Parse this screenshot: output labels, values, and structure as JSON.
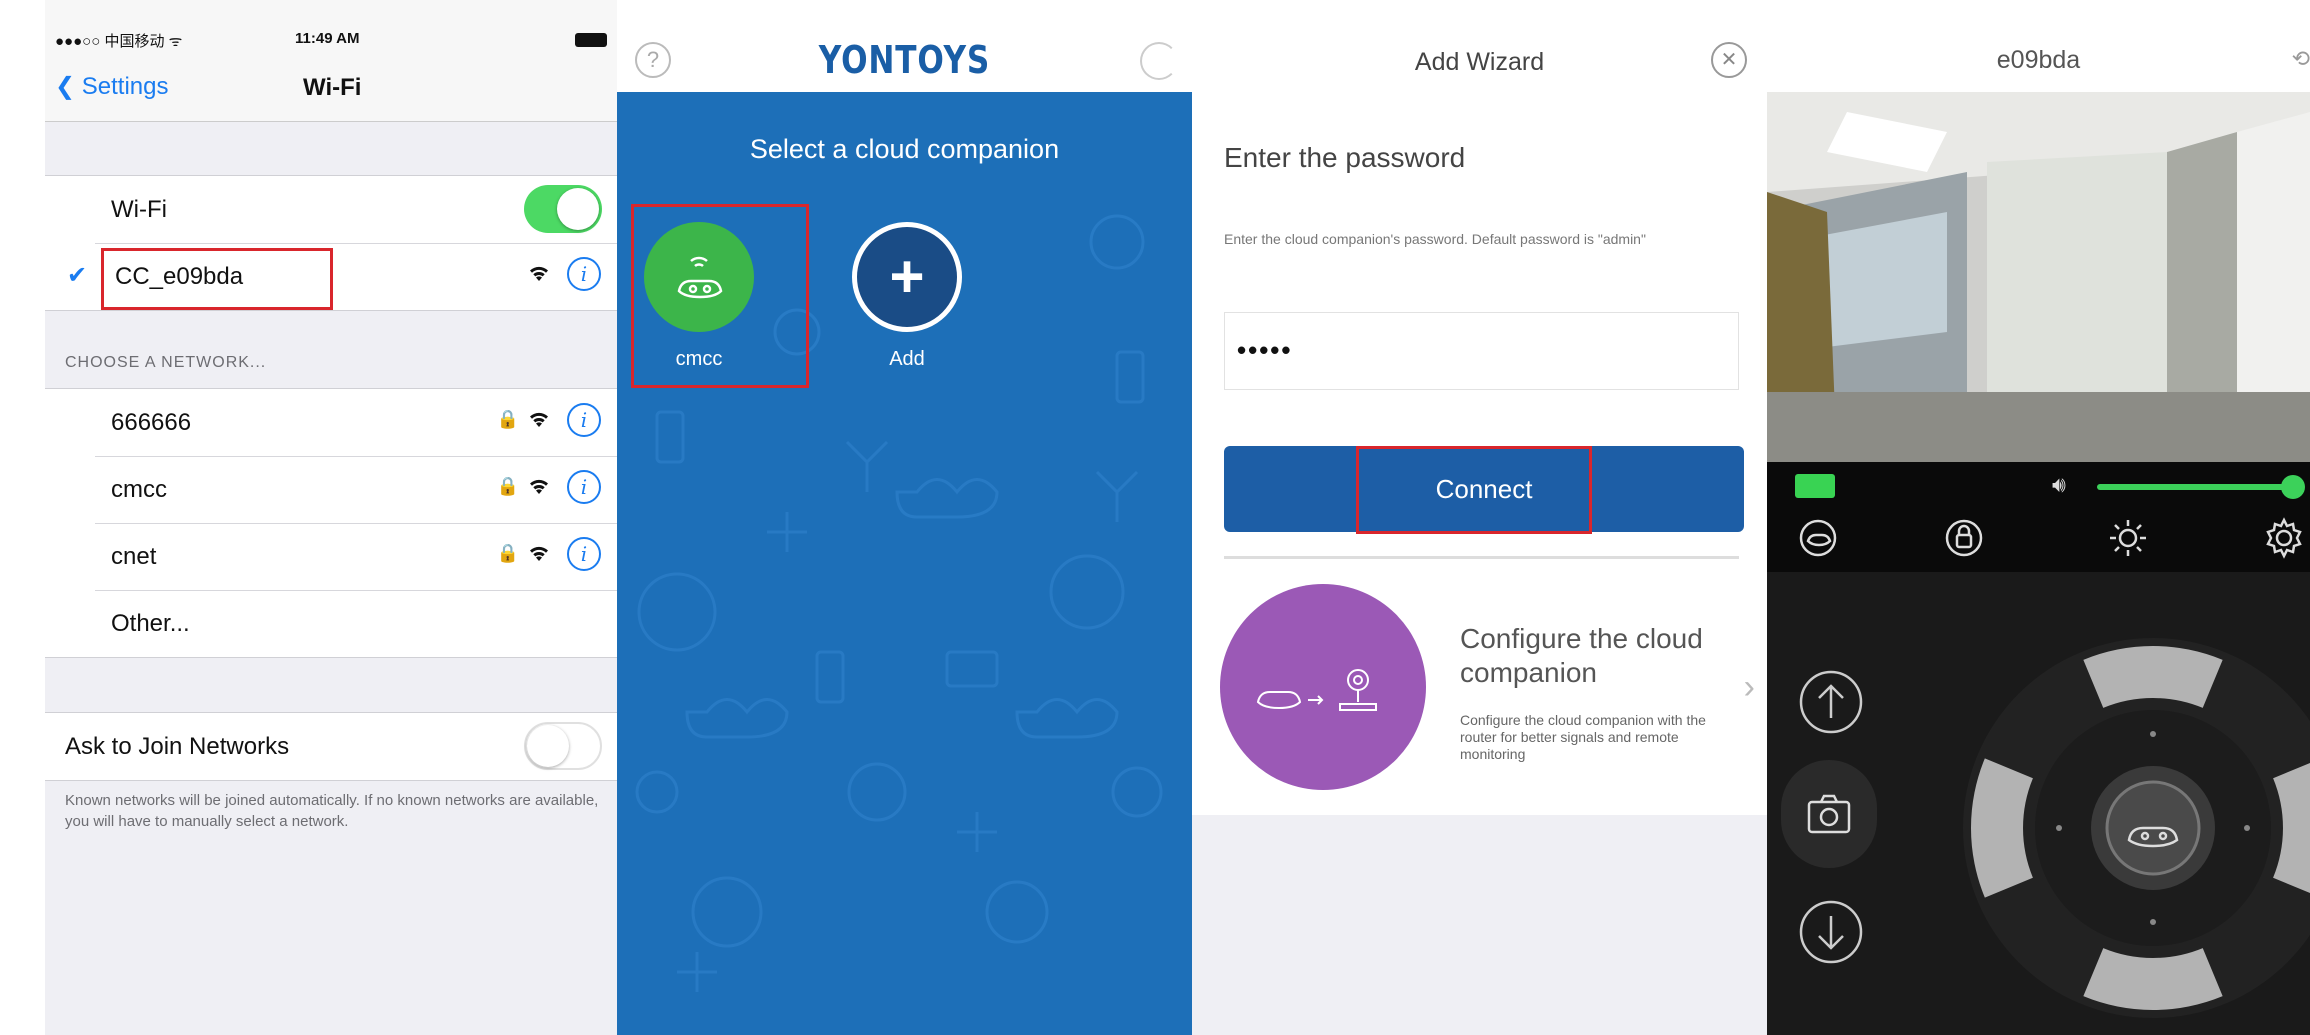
{
  "wifi_panel": {
    "status": {
      "carrier": "●●●○○ 中国移动 ᯤ",
      "time": "11:49 AM"
    },
    "nav": {
      "back_label": "Settings",
      "title": "Wi-Fi"
    },
    "wifi_toggle_label": "Wi-Fi",
    "connected_network": "CC_e09bda",
    "section_header": "CHOOSE A NETWORK...",
    "networks": [
      {
        "name": "666666",
        "locked": true
      },
      {
        "name": "cmcc",
        "locked": true
      },
      {
        "name": "cnet",
        "locked": true
      },
      {
        "name": "Other..."
      }
    ],
    "ask_to_join_label": "Ask to Join Networks",
    "footnote": "Known networks will be joined automatically. If no known networks are available, you will have to manually select a network."
  },
  "companion_panel": {
    "brand": "YONTOYS",
    "subtitle": "Select a cloud companion",
    "devices": [
      {
        "label": "cmcc"
      },
      {
        "label": "Add"
      }
    ]
  },
  "wizard_panel": {
    "title": "Add Wizard",
    "heading": "Enter the password",
    "description": "Enter the cloud companion's password. Default password is \"admin\"",
    "password_masked": "•••••",
    "connect_label": "Connect",
    "configure_title": "Configure the cloud companion",
    "configure_desc": "Configure the cloud companion with the router for better signals and remote monitoring"
  },
  "camera_panel": {
    "title": "e09bda",
    "volume_level": 0.9,
    "colors": {
      "accent_green": "#3cd15a",
      "brand_blue": "#1d5ea6",
      "highlight_red": "#d9262c"
    }
  }
}
